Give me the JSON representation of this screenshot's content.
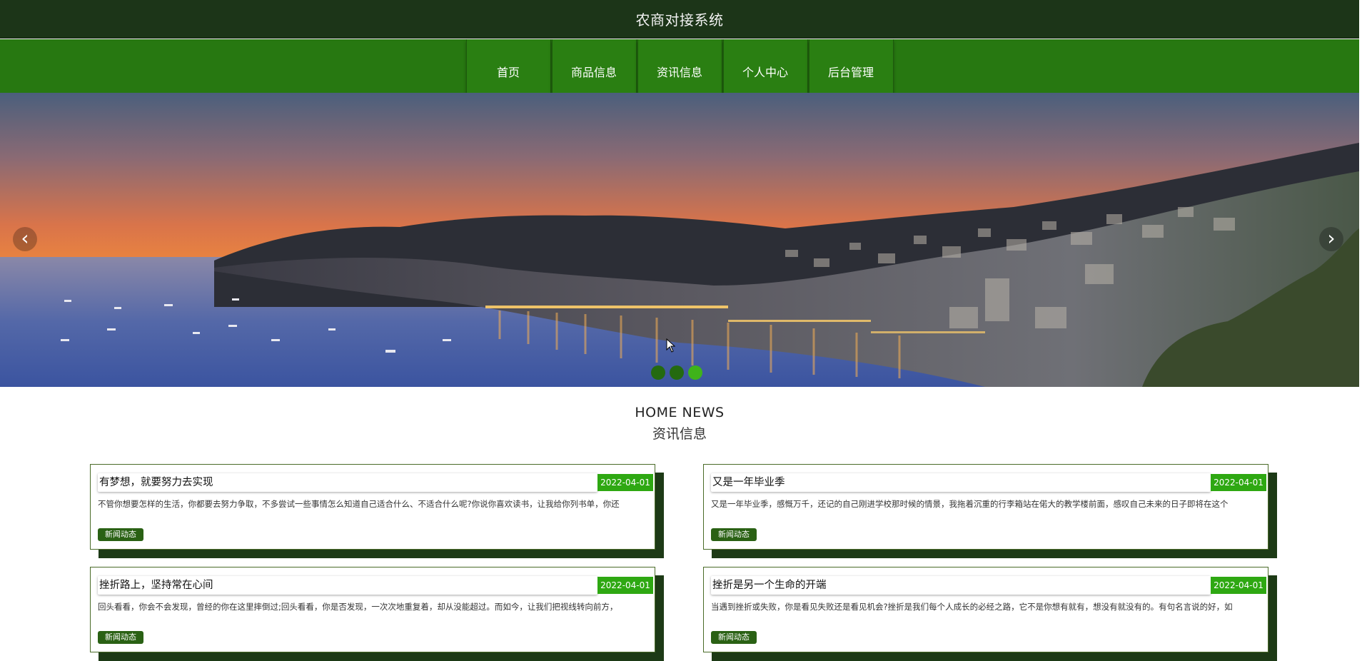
{
  "header": {
    "title": "农商对接系统"
  },
  "nav": {
    "items": [
      {
        "label": "首页"
      },
      {
        "label": "商品信息"
      },
      {
        "label": "资讯信息"
      },
      {
        "label": "个人中心"
      },
      {
        "label": "后台管理"
      }
    ]
  },
  "banner": {
    "prev_icon": "‹",
    "next_icon": "›",
    "slide_count": 3,
    "active_slide": 3,
    "colors": {
      "dot": "#246a10",
      "dot_active": "#3fb31a"
    }
  },
  "news_section": {
    "heading_en": "HOME NEWS",
    "heading_cn": "资讯信息",
    "cards": [
      {
        "title": "有梦想，就要努力去实现",
        "date": "2022-04-01",
        "excerpt": "不管你想要怎样的生活，你都要去努力争取，不多尝试一些事情怎么知道自己适合什么、不适合什么呢?你说你喜欢读书，让我给你列书单，你还",
        "tag": "新闻动态"
      },
      {
        "title": "又是一年毕业季",
        "date": "2022-04-01",
        "excerpt": "又是一年毕业季，感慨万千，还记的自己刚进学校那时候的情景，我拖着沉重的行李箱站在偌大的教学楼前面，感叹自己未来的日子即将在这个",
        "tag": "新闻动态"
      },
      {
        "title": "挫折路上，坚持常在心间",
        "date": "2022-04-01",
        "excerpt": "回头看看，你会不会发现，曾经的你在这里摔倒过;回头看看，你是否发现，一次次地重复着，却从没能超过。而如今，让我们把视线转向前方，",
        "tag": "新闻动态"
      },
      {
        "title": "挫折是另一个生命的开端",
        "date": "2022-04-01",
        "excerpt": "当遇到挫折或失败，你是看见失败还是看见机会?挫折是我们每个人成长的必经之路，它不是你想有就有，想没有就没有的。有句名言说的好，如",
        "tag": "新闻动态"
      }
    ]
  },
  "theme": {
    "header_bg": "#1c3518",
    "nav_bg": "#277811",
    "date_badge": "#2ea812",
    "tag_bg": "#2a6114",
    "card_shadow": "#1d3a16"
  }
}
